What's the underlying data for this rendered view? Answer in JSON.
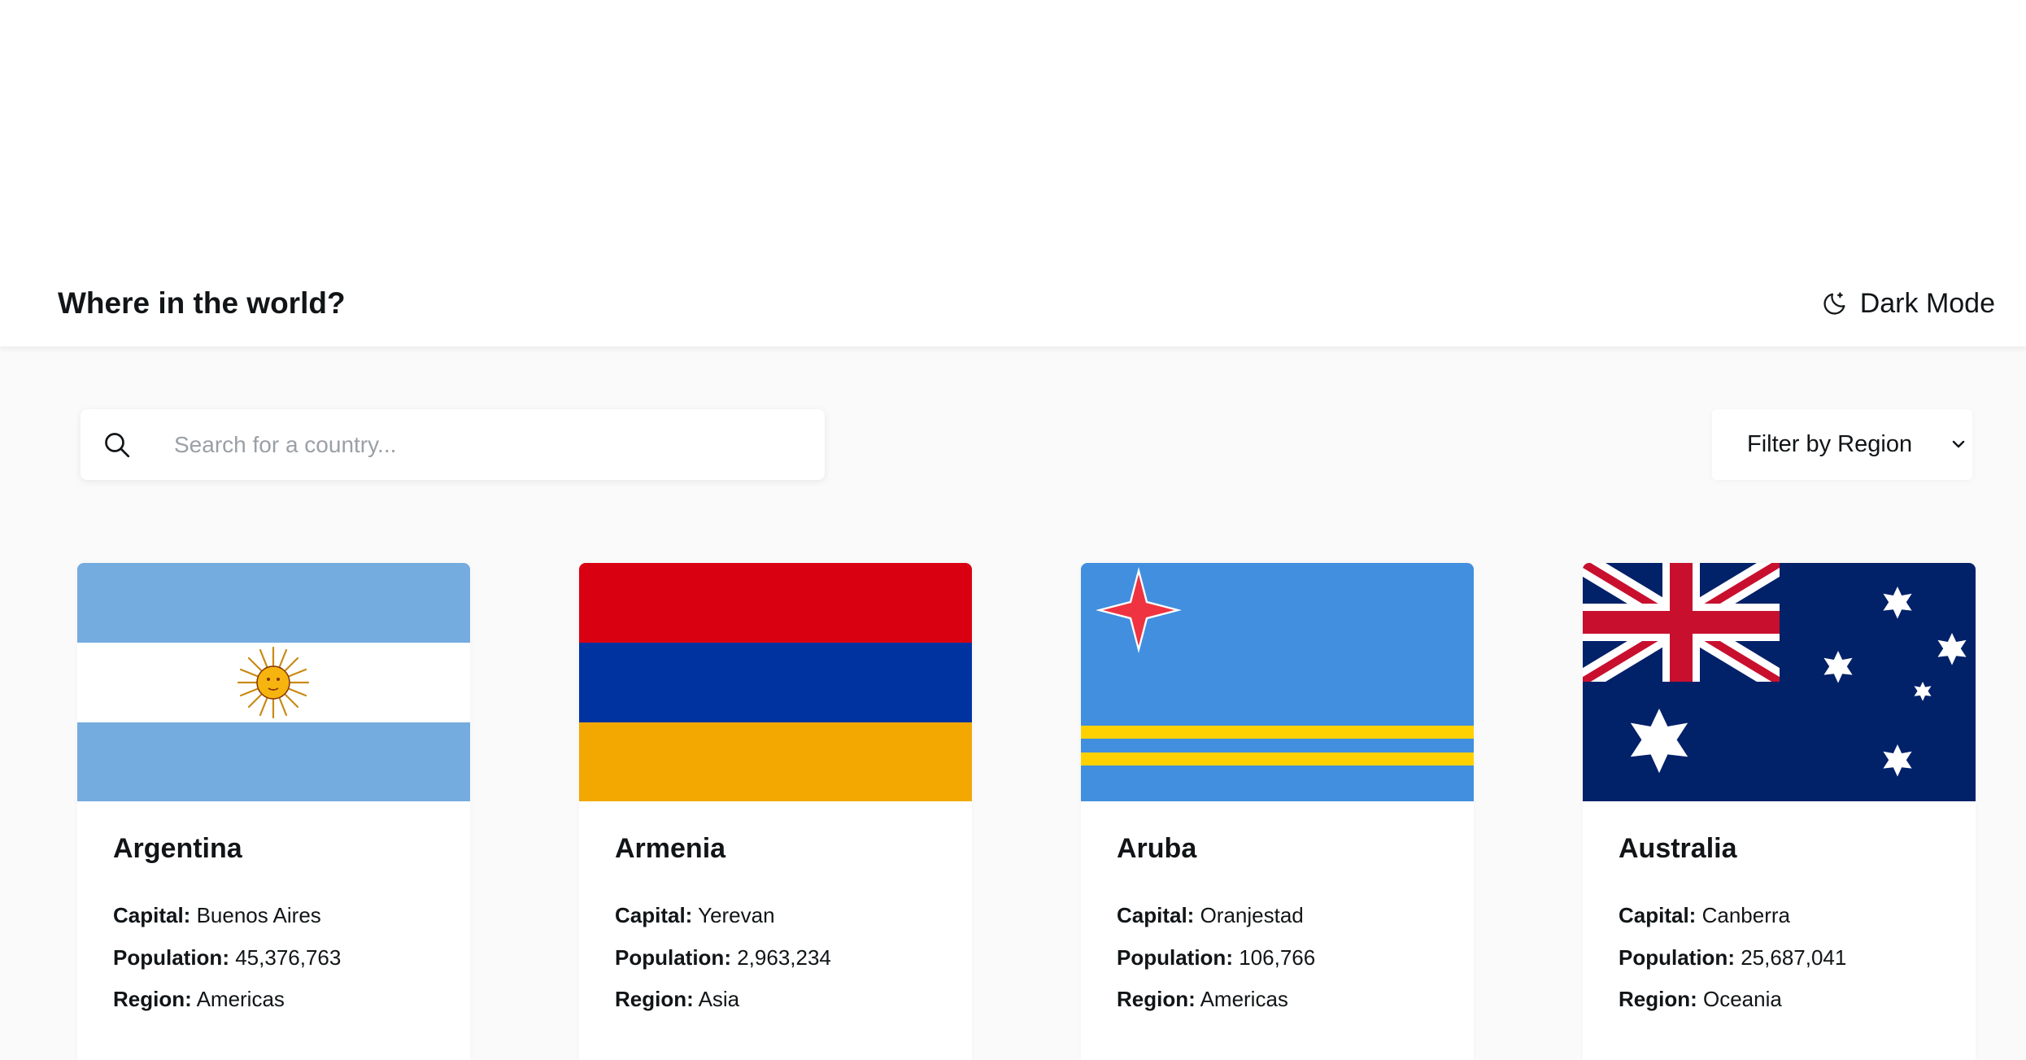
{
  "header": {
    "title": "Where in the world?",
    "theme_toggle_label": "Dark Mode",
    "theme_icon": "moon-icon"
  },
  "search": {
    "placeholder": "Search for a country...",
    "value": "",
    "icon": "search-icon"
  },
  "filter": {
    "label": "Filter by Region",
    "icon": "chevron-down-icon"
  },
  "field_labels": {
    "capital": "Capital:",
    "population": "Population:",
    "region": "Region:"
  },
  "countries": [
    {
      "name": "Argentina",
      "capital": "Buenos Aires",
      "population": "45,376,763",
      "region": "Americas",
      "flag": "argentina-flag"
    },
    {
      "name": "Armenia",
      "capital": "Yerevan",
      "population": "2,963,234",
      "region": "Asia",
      "flag": "armenia-flag"
    },
    {
      "name": "Aruba",
      "capital": "Oranjestad",
      "population": "106,766",
      "region": "Americas",
      "flag": "aruba-flag"
    },
    {
      "name": "Australia",
      "capital": "Canberra",
      "population": "25,687,041",
      "region": "Oceania",
      "flag": "australia-flag"
    }
  ],
  "colors": {
    "text": "#111517",
    "background": "#fafafa",
    "element": "#ffffff",
    "placeholder": "#9aa0a6"
  }
}
